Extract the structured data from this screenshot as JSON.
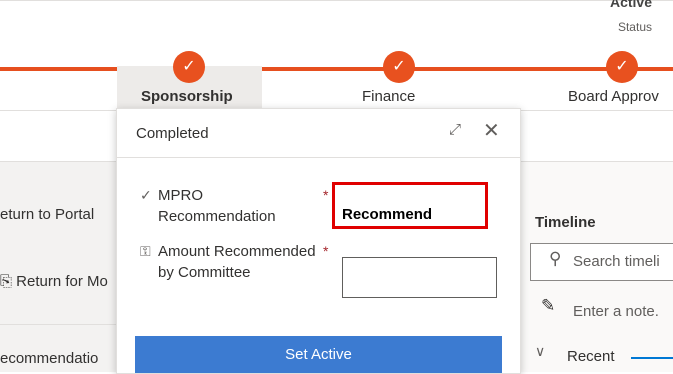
{
  "header": {
    "status_value": "Active",
    "status_label": "Status"
  },
  "stages": [
    {
      "label": "Sponsorship",
      "state": "completed",
      "active": true
    },
    {
      "label": "Finance",
      "state": "completed",
      "active": false
    },
    {
      "label": "Board Approv",
      "state": "completed",
      "active": false
    }
  ],
  "left_panel": {
    "return_to_portal": "eturn to Portal",
    "return_for": "Return for Mo",
    "recommendation": "ecommendatio"
  },
  "flyout": {
    "title": "Completed",
    "fields": [
      {
        "label": "MPRO Recommendation",
        "value": "Recommend",
        "required": true,
        "icon": "check-icon"
      },
      {
        "label": "Amount Recommended by Committee",
        "value": "",
        "required": true,
        "icon": "key-icon"
      }
    ],
    "button_label": "Set Active"
  },
  "timeline": {
    "title": "Timeline",
    "search_placeholder": "Search timeli",
    "note_placeholder": "Enter a note.",
    "recent_label": "Recent"
  },
  "colors": {
    "stage_accent": "#e8511f",
    "highlight_box": "#e00000",
    "primary_button": "#3c7bd1"
  }
}
